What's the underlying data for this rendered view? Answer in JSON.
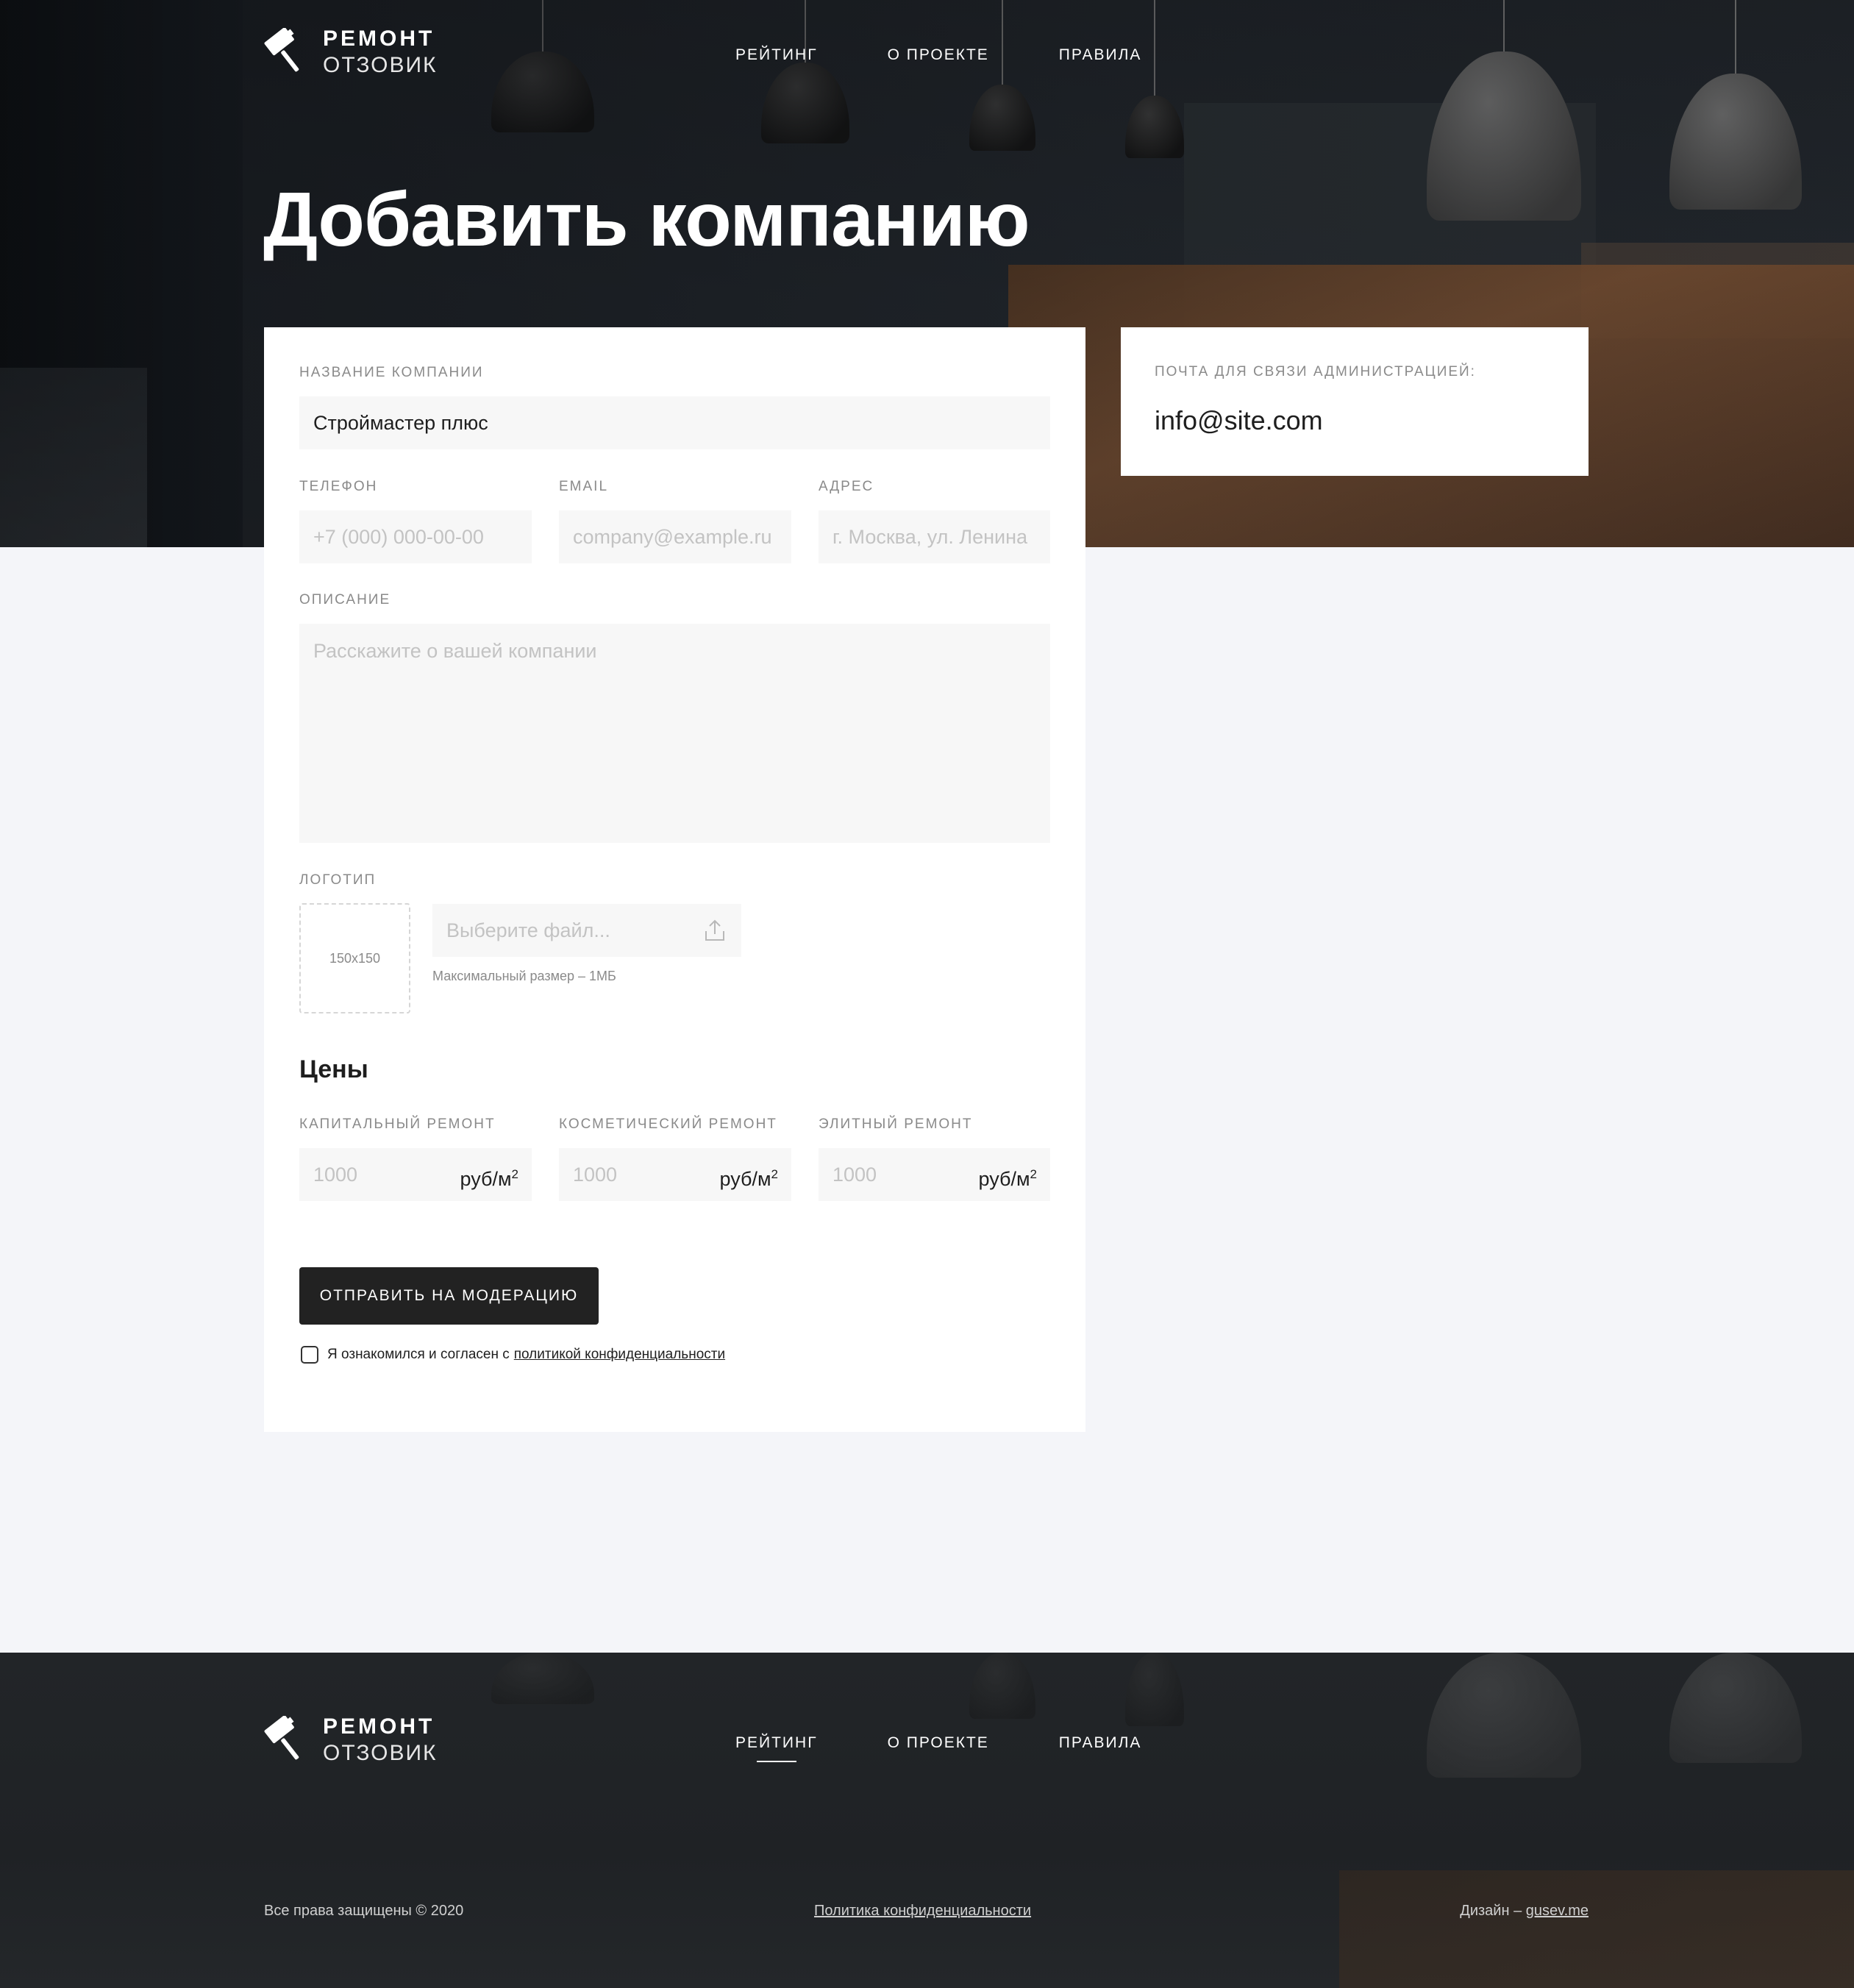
{
  "brand": {
    "line1": "РЕМОНТ",
    "line2": "ОТЗОВИК"
  },
  "nav": [
    {
      "label": "РЕЙТИНГ"
    },
    {
      "label": "О ПРОЕКТЕ"
    },
    {
      "label": "ПРАВИЛА"
    }
  ],
  "page_title": "Добавить компанию",
  "form": {
    "company_name": {
      "label": "НАЗВАНИЕ КОМПАНИИ",
      "value": "Строймастер плюс"
    },
    "phone": {
      "label": "ТЕЛЕФОН",
      "placeholder": "+7 (000) 000-00-00"
    },
    "email": {
      "label": "EMAIL",
      "placeholder": "company@example.ru"
    },
    "address": {
      "label": "АДРЕС",
      "placeholder": "г. Москва, ул. Ленина"
    },
    "description": {
      "label": "ОПИСАНИЕ",
      "placeholder": "Расскажите о вашей компании"
    },
    "logo": {
      "label": "ЛОГОТИП",
      "preview_size": "150x150",
      "file_placeholder": "Выберите файл...",
      "hint": "Максимальный размер – 1МБ"
    },
    "prices": {
      "heading": "Цены",
      "unit": "руб/м",
      "unit_sup": "2",
      "items": [
        {
          "label": "КАПИТАЛЬНЫЙ РЕМОНТ",
          "placeholder": "1000"
        },
        {
          "label": "КОСМЕТИЧЕСКИЙ РЕМОНТ",
          "placeholder": "1000"
        },
        {
          "label": "ЭЛИТНЫЙ РЕМОНТ",
          "placeholder": "1000"
        }
      ]
    },
    "submit_label": "ОТПРАВИТЬ НА МОДЕРАЦИЮ",
    "agree_text": "Я ознакомился и согласен с",
    "agree_link": "политикой конфиденциальности"
  },
  "contact": {
    "label": "ПОЧТА ДЛЯ СВЯЗИ АДМИНИСТРАЦИЕЙ:",
    "email": "info@site.com"
  },
  "footer": {
    "copyright": "Все права защищены © 2020",
    "policy": "Политика конфиденциальности",
    "design_label": "Дизайн –",
    "design_link": "gusev.me"
  }
}
